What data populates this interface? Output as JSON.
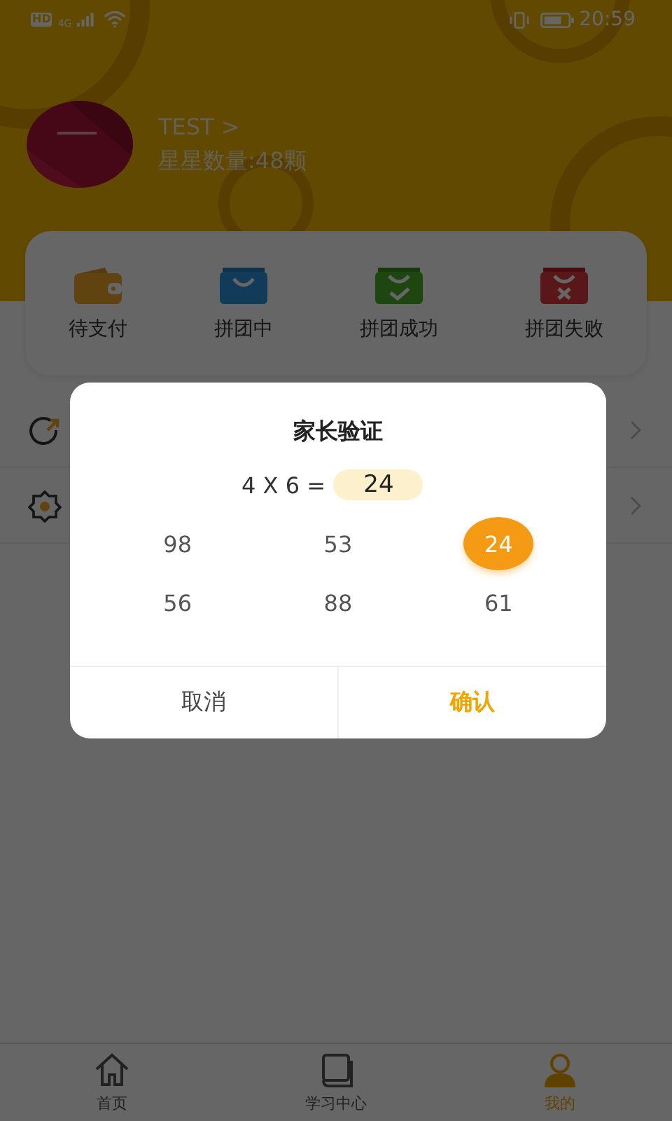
{
  "status_bar": {
    "network_badge": "HD",
    "network_type": "4G",
    "time": "20:59"
  },
  "profile": {
    "name": "TEST >",
    "stars": "星星数量:48颗"
  },
  "order_shortcuts": [
    {
      "kind": "wallet",
      "label": "待支付"
    },
    {
      "kind": "bag",
      "label": "拼团中"
    },
    {
      "kind": "success",
      "label": "拼团成功"
    },
    {
      "kind": "fail",
      "label": "拼团失败"
    }
  ],
  "menu_rows": [
    {
      "kind": "refresh"
    },
    {
      "kind": "settings"
    }
  ],
  "dialog": {
    "title": "家长验证",
    "question": "4 X 6 =",
    "answer": "24",
    "options": [
      {
        "label": "98",
        "selected": false
      },
      {
        "label": "53",
        "selected": false
      },
      {
        "label": "24",
        "selected": true
      },
      {
        "label": "56",
        "selected": false
      },
      {
        "label": "88",
        "selected": false
      },
      {
        "label": "61",
        "selected": false
      }
    ],
    "cancel": "取消",
    "confirm": "确认"
  },
  "tabs": [
    {
      "kind": "home",
      "label": "首页",
      "selected": false
    },
    {
      "kind": "book",
      "label": "学习中心",
      "selected": false
    },
    {
      "kind": "person",
      "label": "我的",
      "selected": true
    }
  ]
}
